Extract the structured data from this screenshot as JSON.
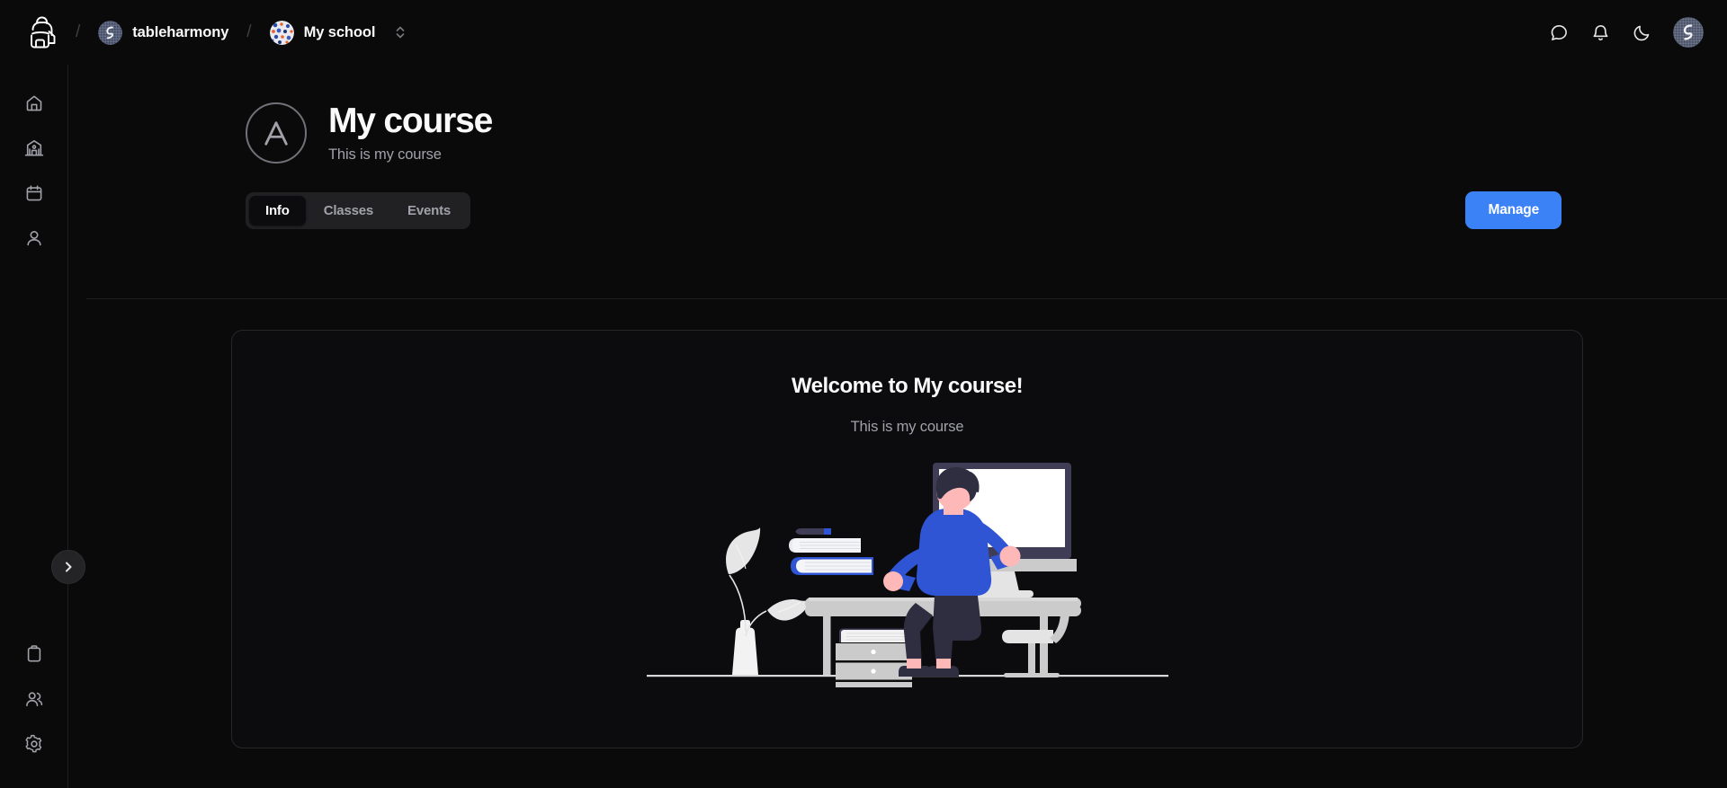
{
  "topbar": {
    "brand_icon": "backpack-logo-icon",
    "separator": "/",
    "org": {
      "label": "tableharmony",
      "avatar_icon": "tableharmony-badge-icon"
    },
    "school": {
      "label": "My school",
      "avatar_icon": "school-identicon-avatar",
      "switcher_icon": "chevron-up-down-icon"
    },
    "actions": [
      {
        "name": "chat-icon",
        "title": "Chat"
      },
      {
        "name": "bell-icon",
        "title": "Notifications"
      },
      {
        "name": "moon-icon",
        "title": "Toggle theme"
      }
    ],
    "user_avatar_icon": "user-avatar"
  },
  "sidebar": {
    "top_items": [
      {
        "name": "sidebar-item-home",
        "icon": "home-icon"
      },
      {
        "name": "sidebar-item-school",
        "icon": "school-building-icon"
      },
      {
        "name": "sidebar-item-calendar",
        "icon": "calendar-icon"
      },
      {
        "name": "sidebar-item-profile",
        "icon": "user-icon"
      }
    ],
    "bottom_items": [
      {
        "name": "sidebar-item-clipboard",
        "icon": "clipboard-icon"
      },
      {
        "name": "sidebar-item-members",
        "icon": "users-icon"
      },
      {
        "name": "sidebar-item-settings",
        "icon": "gear-icon"
      }
    ],
    "collapse_icon": "chevron-right-icon"
  },
  "course": {
    "avatar_icon": "course-appstore-a-icon",
    "title": "My course",
    "subtitle": "This is my course",
    "tabs": [
      {
        "label": "Info",
        "active": true
      },
      {
        "label": "Classes",
        "active": false
      },
      {
        "label": "Events",
        "active": false
      }
    ],
    "manage_label": "Manage"
  },
  "content": {
    "welcome_title": "Welcome to My course!",
    "welcome_subtitle": "This is my course",
    "illustration_name": "person-at-desk-illustration"
  },
  "colors": {
    "background": "#0a0a0a",
    "card_background": "#0c0c0e",
    "border": "#27272a",
    "accent_blue": "#3b82f6",
    "text_primary": "#fafafa",
    "text_muted": "#a1a1aa",
    "tabs_track": "#212124",
    "illustration_shirt": "#2f55d4",
    "illustration_pants": "#2f2e41",
    "illustration_skin": "#ffb8b8",
    "illustration_gray": "#cbcbcb"
  }
}
